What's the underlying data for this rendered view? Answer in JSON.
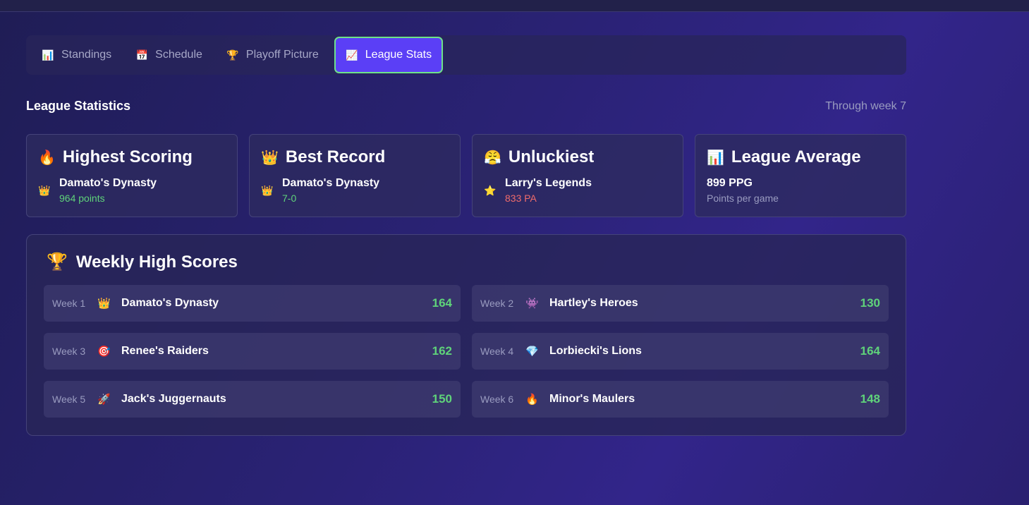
{
  "tabs": [
    {
      "icon": "📊",
      "label": "Standings"
    },
    {
      "icon": "📅",
      "label": "Schedule"
    },
    {
      "icon": "🏆",
      "label": "Playoff Picture"
    },
    {
      "icon": "📈",
      "label": "League Stats"
    }
  ],
  "section": {
    "title": "League Statistics",
    "subtitle": "Through week 7"
  },
  "cards": [
    {
      "icon": "🔥",
      "title": "Highest Scoring",
      "team_icon": "👑",
      "name": "Damato's Dynasty",
      "value": "964 points"
    },
    {
      "icon": "👑",
      "title": "Best Record",
      "team_icon": "👑",
      "name": "Damato's Dynasty",
      "value": "7-0"
    },
    {
      "icon": "😤",
      "title": "Unluckiest",
      "team_icon": "⭐",
      "name": "Larry's Legends",
      "value": "833 PA"
    },
    {
      "icon": "📊",
      "title": "League Average",
      "name": "899 PPG",
      "value": "Points per game"
    }
  ],
  "weekly": {
    "icon": "🏆",
    "title": "Weekly High Scores",
    "rows": [
      {
        "week": "Week 1",
        "icon": "👑",
        "team": "Damato's Dynasty",
        "score": "164"
      },
      {
        "week": "Week 2",
        "icon": "👾",
        "team": "Hartley's Heroes",
        "score": "130"
      },
      {
        "week": "Week 3",
        "icon": "🎯",
        "team": "Renee's Raiders",
        "score": "162"
      },
      {
        "week": "Week 4",
        "icon": "💎",
        "team": "Lorbiecki's Lions",
        "score": "164"
      },
      {
        "week": "Week 5",
        "icon": "🚀",
        "team": "Jack's Juggernauts",
        "score": "150"
      },
      {
        "week": "Week 6",
        "icon": "🔥",
        "team": "Minor's Maulers",
        "score": "148"
      }
    ]
  },
  "colors": {
    "accent": "#5b3ff6",
    "active_border": "#6ee28a",
    "positive": "#5fd37a",
    "negative": "#f06b6b"
  }
}
